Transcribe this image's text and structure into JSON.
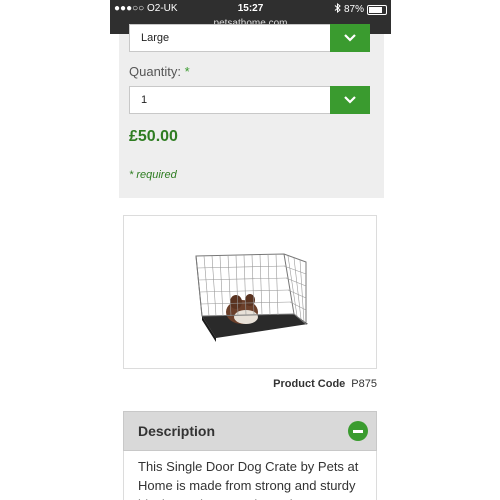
{
  "status_bar": {
    "carrier": "●●●○○ O2-UK",
    "time": "15:27",
    "battery_percent": "87%",
    "url": "petsathome.com"
  },
  "product": {
    "size_selected": "Large",
    "quantity_label": "Quantity:",
    "quantity_required_mark": "*",
    "quantity_value": "1",
    "price": "£50.00",
    "required_note": "* required",
    "code_label": "Product Code",
    "code_value": "P875"
  },
  "description": {
    "title": "Description",
    "text": "This Single Door Dog Crate by Pets at Home is made from strong and sturdy black powder coated metal"
  },
  "colors": {
    "accent_green": "#3a9b2f",
    "price_green": "#2f7d22",
    "panel_grey": "#eeeeee",
    "status_bar": "#2f2f2f"
  },
  "icons": {
    "dropdown": "chevron-down-icon",
    "collapse": "minus-circle-icon",
    "wifi": "wifi-icon",
    "bluetooth": "bluetooth-icon",
    "battery": "battery-icon"
  }
}
